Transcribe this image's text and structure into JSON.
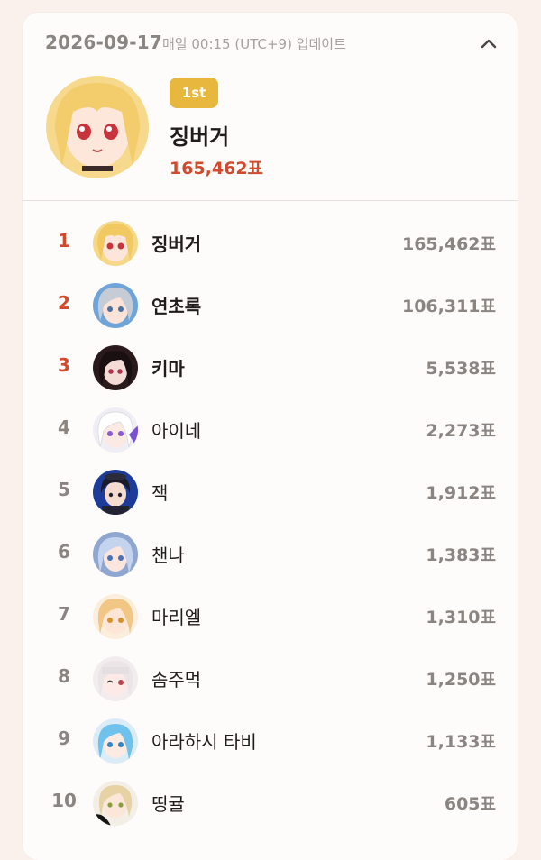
{
  "header": {
    "date": "2026-09-17",
    "update_text": "매일 00:15 (UTC+9) 업데이트"
  },
  "winner": {
    "badge": "1st",
    "name": "징버거",
    "votes": "165,462표"
  },
  "ranking": [
    {
      "rank": "1",
      "name": "징버거",
      "votes": "165,462표"
    },
    {
      "rank": "2",
      "name": "연초록",
      "votes": "106,311표"
    },
    {
      "rank": "3",
      "name": "키마",
      "votes": "5,538표"
    },
    {
      "rank": "4",
      "name": "아이네",
      "votes": "2,273표"
    },
    {
      "rank": "5",
      "name": "잭",
      "votes": "1,912표"
    },
    {
      "rank": "6",
      "name": "챈나",
      "votes": "1,383표"
    },
    {
      "rank": "7",
      "name": "마리엘",
      "votes": "1,310표"
    },
    {
      "rank": "8",
      "name": "솜주먹",
      "votes": "1,250표"
    },
    {
      "rank": "9",
      "name": "아라하시 타비",
      "votes": "1,133표"
    },
    {
      "rank": "10",
      "name": "띵귤",
      "votes": "605표"
    }
  ],
  "colors": {
    "page_bg": "#fbf1ec",
    "card_bg": "#fefcfb",
    "badge": "#e8b73d",
    "accent_red": "#d04a2e",
    "muted": "#8b8582"
  },
  "icons": {
    "collapse": "chevron-up-icon"
  }
}
